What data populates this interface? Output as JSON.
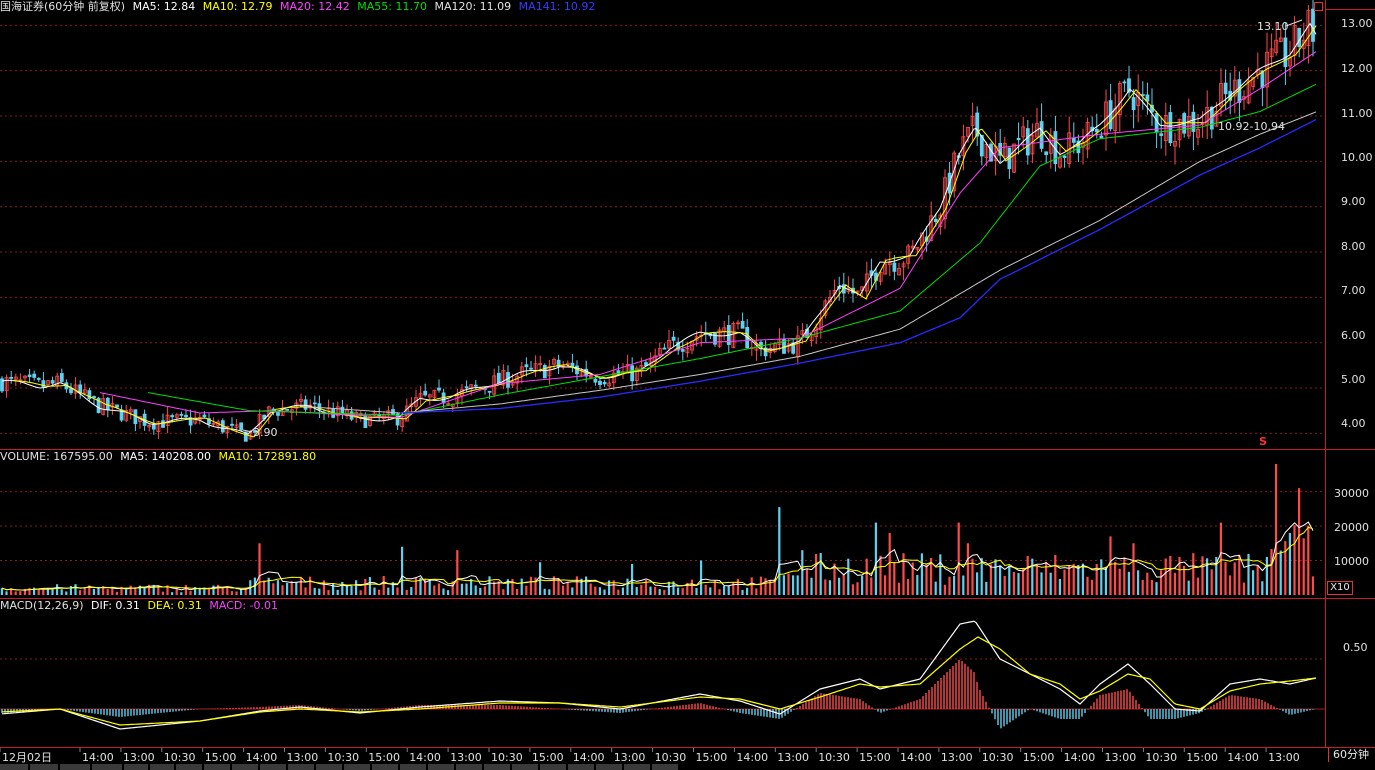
{
  "main_panel": {
    "legend": {
      "title": "国海证券(60分钟 前复权)",
      "ma5": "MA5: 12.84",
      "ma10": "MA10: 12.79",
      "ma20": "MA20: 12.42",
      "ma55": "MA55: 11.70",
      "ma120": "MA120: 11.09",
      "ma141": "MA141: 10.92"
    },
    "price_ticks": [
      "13.00",
      "12.00",
      "11.00",
      "10.00",
      "9.00",
      "8.00",
      "7.00",
      "6.00",
      "5.00",
      "4.00"
    ],
    "annotations": {
      "high_label": "13.10",
      "low_label": "3.90",
      "range_label": "10.92-10.94",
      "signal_mark": "S"
    }
  },
  "volume_panel": {
    "legend": {
      "volume": "VOLUME: 167595.00",
      "ma5": "MA5: 140208.00",
      "ma10": "MA10: 172891.80"
    },
    "ticks": [
      "30000",
      "20000",
      "10000"
    ],
    "unit_label": "X10"
  },
  "macd_panel": {
    "legend": {
      "params": "MACD(12,26,9)",
      "dif": "DIF: 0.31",
      "dea": "DEA: 0.31",
      "macd": "MACD: -0.01"
    },
    "ticks": [
      "0.50"
    ]
  },
  "time_axis": {
    "labels": [
      "12月02日",
      "14:00",
      "13:00",
      "10:30",
      "15:00",
      "14:00",
      "13:00",
      "10:30",
      "15:00",
      "14:00",
      "13:00",
      "10:30",
      "15:00",
      "14:00",
      "13:00",
      "10:30",
      "15:00",
      "14:00",
      "13:00",
      "10:30",
      "15:00",
      "14:00",
      "13:00",
      "10:30",
      "15:00",
      "14:00",
      "13:00",
      "10:30",
      "15:00",
      "14:00",
      "13:00"
    ],
    "period_label": "60分钟"
  },
  "colors": {
    "ma5": "#ffffff",
    "ma10": "#ffff00",
    "ma20": "#ff40ff",
    "ma55": "#00dd00",
    "ma120": "#c8c8c8",
    "ma141": "#2a2aff",
    "up": "#ff4a4a",
    "down": "#60d0f0",
    "grid": "#8a1c1c",
    "border": "#c02020",
    "axis_text": "#e0e0e0"
  },
  "chart_data": {
    "type": "candlestick",
    "price_range": [
      3.7,
      13.25
    ],
    "volume_range": [
      0,
      38000
    ],
    "macd_range": [
      -0.35,
      0.95
    ],
    "close_anchors": [
      [
        0,
        5.15
      ],
      [
        40,
        5.05
      ],
      [
        60,
        5.1
      ],
      [
        100,
        4.6
      ],
      [
        150,
        4.25
      ],
      [
        200,
        4.3
      ],
      [
        248,
        3.95
      ],
      [
        270,
        4.5
      ],
      [
        310,
        4.6
      ],
      [
        360,
        4.3
      ],
      [
        400,
        4.35
      ],
      [
        420,
        4.75
      ],
      [
        450,
        4.8
      ],
      [
        520,
        5.3
      ],
      [
        560,
        5.5
      ],
      [
        600,
        5.25
      ],
      [
        640,
        5.35
      ],
      [
        670,
        5.9
      ],
      [
        700,
        6.2
      ],
      [
        740,
        6.2
      ],
      [
        760,
        5.85
      ],
      [
        800,
        6.0
      ],
      [
        840,
        7.3
      ],
      [
        860,
        7.0
      ],
      [
        880,
        7.8
      ],
      [
        910,
        7.9
      ],
      [
        940,
        9.0
      ],
      [
        960,
        10.2
      ],
      [
        975,
        10.7
      ],
      [
        1000,
        10.0
      ],
      [
        1040,
        10.7
      ],
      [
        1060,
        10.2
      ],
      [
        1080,
        10.4
      ],
      [
        1100,
        10.8
      ],
      [
        1130,
        11.6
      ],
      [
        1160,
        10.8
      ],
      [
        1200,
        10.9
      ],
      [
        1230,
        11.5
      ],
      [
        1260,
        12.0
      ],
      [
        1290,
        12.4
      ],
      [
        1310,
        13.0
      ],
      [
        1316,
        12.75
      ]
    ],
    "ma_anchors": {
      "ma20": [
        [
          100,
          4.9
        ],
        [
          200,
          4.45
        ],
        [
          270,
          4.5
        ],
        [
          400,
          4.35
        ],
        [
          500,
          5.1
        ],
        [
          600,
          5.3
        ],
        [
          700,
          6.0
        ],
        [
          800,
          6.1
        ],
        [
          900,
          7.2
        ],
        [
          960,
          9.3
        ],
        [
          1000,
          10.3
        ],
        [
          1100,
          10.6
        ],
        [
          1200,
          10.8
        ],
        [
          1260,
          11.6
        ],
        [
          1316,
          12.42
        ]
      ],
      "ma55": [
        [
          148,
          4.9
        ],
        [
          250,
          4.5
        ],
        [
          400,
          4.4
        ],
        [
          500,
          4.85
        ],
        [
          600,
          5.25
        ],
        [
          700,
          5.65
        ],
        [
          800,
          6.1
        ],
        [
          900,
          6.7
        ],
        [
          980,
          8.2
        ],
        [
          1040,
          9.9
        ],
        [
          1100,
          10.5
        ],
        [
          1200,
          10.75
        ],
        [
          1260,
          11.1
        ],
        [
          1316,
          11.7
        ]
      ],
      "ma120": [
        [
          300,
          4.6
        ],
        [
          400,
          4.45
        ],
        [
          500,
          4.65
        ],
        [
          600,
          4.95
        ],
        [
          700,
          5.3
        ],
        [
          800,
          5.7
        ],
        [
          900,
          6.3
        ],
        [
          1000,
          7.6
        ],
        [
          1100,
          8.7
        ],
        [
          1200,
          10.0
        ],
        [
          1260,
          10.6
        ],
        [
          1316,
          11.09
        ]
      ],
      "ma141": [
        [
          400,
          4.45
        ],
        [
          500,
          4.55
        ],
        [
          600,
          4.8
        ],
        [
          700,
          5.15
        ],
        [
          800,
          5.55
        ],
        [
          900,
          6.0
        ],
        [
          960,
          6.55
        ],
        [
          1000,
          7.4
        ],
        [
          1100,
          8.5
        ],
        [
          1200,
          9.7
        ],
        [
          1260,
          10.3
        ],
        [
          1316,
          10.92
        ]
      ]
    },
    "volume_spikes": [
      [
        258,
        15000
      ],
      [
        404,
        14000
      ],
      [
        456,
        13000
      ],
      [
        541,
        9500
      ],
      [
        632,
        9000
      ],
      [
        700,
        10000
      ],
      [
        780,
        25500
      ],
      [
        803,
        13000
      ],
      [
        874,
        21000
      ],
      [
        891,
        18000
      ],
      [
        957,
        21000
      ],
      [
        970,
        15000
      ],
      [
        1110,
        17000
      ],
      [
        1135,
        15000
      ],
      [
        1221,
        21000
      ],
      [
        1275,
        38000
      ],
      [
        1297,
        31000
      ]
    ],
    "macd_dif": [
      [
        0,
        -0.05
      ],
      [
        60,
        0.0
      ],
      [
        120,
        -0.2
      ],
      [
        200,
        -0.12
      ],
      [
        260,
        -0.02
      ],
      [
        300,
        0.02
      ],
      [
        360,
        -0.04
      ],
      [
        420,
        0.02
      ],
      [
        500,
        0.08
      ],
      [
        560,
        0.06
      ],
      [
        620,
        0.0
      ],
      [
        700,
        0.15
      ],
      [
        740,
        0.08
      ],
      [
        780,
        -0.05
      ],
      [
        820,
        0.2
      ],
      [
        860,
        0.3
      ],
      [
        880,
        0.2
      ],
      [
        920,
        0.3
      ],
      [
        960,
        0.85
      ],
      [
        975,
        0.88
      ],
      [
        1000,
        0.5
      ],
      [
        1030,
        0.35
      ],
      [
        1060,
        0.2
      ],
      [
        1080,
        0.05
      ],
      [
        1100,
        0.25
      ],
      [
        1128,
        0.45
      ],
      [
        1150,
        0.25
      ],
      [
        1175,
        0.0
      ],
      [
        1200,
        -0.02
      ],
      [
        1230,
        0.25
      ],
      [
        1260,
        0.3
      ],
      [
        1290,
        0.25
      ],
      [
        1316,
        0.31
      ]
    ],
    "macd_dea": [
      [
        0,
        -0.03
      ],
      [
        60,
        0.0
      ],
      [
        120,
        -0.16
      ],
      [
        200,
        -0.12
      ],
      [
        260,
        -0.03
      ],
      [
        300,
        0.0
      ],
      [
        360,
        -0.03
      ],
      [
        420,
        0.0
      ],
      [
        500,
        0.06
      ],
      [
        560,
        0.06
      ],
      [
        620,
        0.02
      ],
      [
        700,
        0.12
      ],
      [
        740,
        0.1
      ],
      [
        780,
        0.0
      ],
      [
        820,
        0.12
      ],
      [
        860,
        0.25
      ],
      [
        880,
        0.22
      ],
      [
        920,
        0.25
      ],
      [
        960,
        0.6
      ],
      [
        978,
        0.72
      ],
      [
        1000,
        0.6
      ],
      [
        1030,
        0.35
      ],
      [
        1060,
        0.25
      ],
      [
        1080,
        0.1
      ],
      [
        1100,
        0.18
      ],
      [
        1128,
        0.35
      ],
      [
        1150,
        0.3
      ],
      [
        1175,
        0.05
      ],
      [
        1200,
        0.0
      ],
      [
        1230,
        0.18
      ],
      [
        1260,
        0.25
      ],
      [
        1290,
        0.28
      ],
      [
        1316,
        0.31
      ]
    ],
    "price_annotations": {
      "high": 13.1,
      "low": 3.9,
      "range_low": 10.92,
      "range_high": 10.94
    }
  }
}
